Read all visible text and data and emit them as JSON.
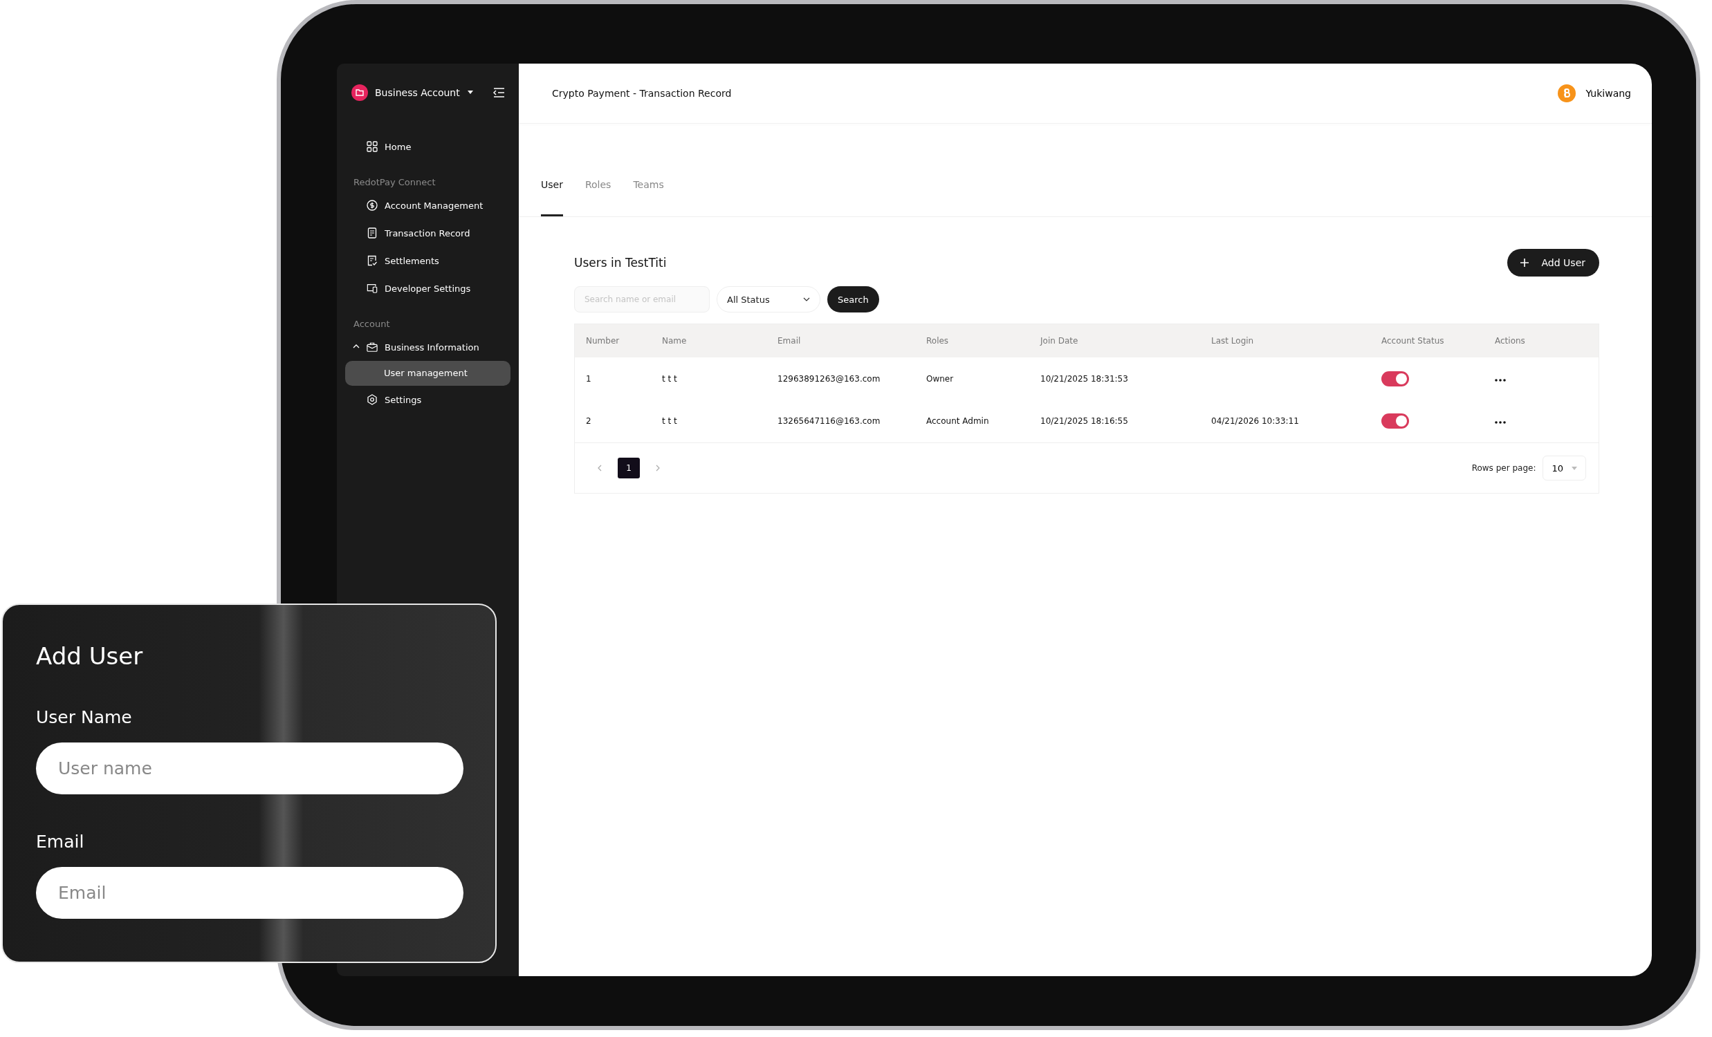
{
  "sidebar": {
    "account": {
      "label": "Business Account"
    },
    "items": [
      {
        "label": "Home",
        "kind": "grid",
        "selected": false
      }
    ],
    "sections": [
      {
        "heading": "RedotPay Connect",
        "items": [
          {
            "label": "Account Management",
            "kind": "dollar",
            "selected": false
          },
          {
            "label": "Transaction Record",
            "kind": "document",
            "selected": false
          },
          {
            "label": "Settlements",
            "kind": "checklist",
            "selected": false
          },
          {
            "label": "Developer Settings",
            "kind": "devices",
            "selected": false
          }
        ]
      },
      {
        "heading": "Account",
        "items": [
          {
            "label": "Business Information",
            "kind": "briefcase",
            "selected": false,
            "expanded": true,
            "children": [
              {
                "label": "User management",
                "selected": true
              }
            ]
          },
          {
            "label": "Settings",
            "kind": "gear",
            "selected": false
          }
        ]
      }
    ]
  },
  "header": {
    "title": "Crypto Payment - Transaction Record",
    "user": "Yukiwang"
  },
  "tabs": [
    {
      "label": "User",
      "selected": true
    },
    {
      "label": "Roles",
      "selected": false
    },
    {
      "label": "Teams",
      "selected": false
    }
  ],
  "section_title": "Users in TestTiti",
  "add_button": "Add User",
  "search": {
    "placeholder": "Search name or email"
  },
  "status_filter": {
    "value": "All Status"
  },
  "search_button": "Search",
  "table": {
    "columns": [
      "Number",
      "Name",
      "Email",
      "Roles",
      "Join Date",
      "Last Login",
      "Account Status",
      "Actions"
    ],
    "rows": [
      {
        "number": "1",
        "name": "t t t",
        "email": "12963891263@163.com",
        "role": "Owner",
        "join_date": "10/21/2025 18:31:53",
        "last_login": "",
        "active": true
      },
      {
        "number": "2",
        "name": "t t t",
        "email": "13265647116@163.com",
        "role": "Account Admin",
        "join_date": "10/21/2025 18:16:55",
        "last_login": "04/21/2026 10:33:11",
        "active": true
      }
    ]
  },
  "pagination": {
    "pages": [
      {
        "label": "1",
        "selected": true
      }
    ],
    "rows_per_page_label": "Rows per page:",
    "rows_per_page": "10"
  },
  "add_user_card": {
    "title": "Add User",
    "fields": [
      {
        "label": "User Name",
        "placeholder": "User name"
      },
      {
        "label": "Email",
        "placeholder": "Email"
      }
    ]
  }
}
